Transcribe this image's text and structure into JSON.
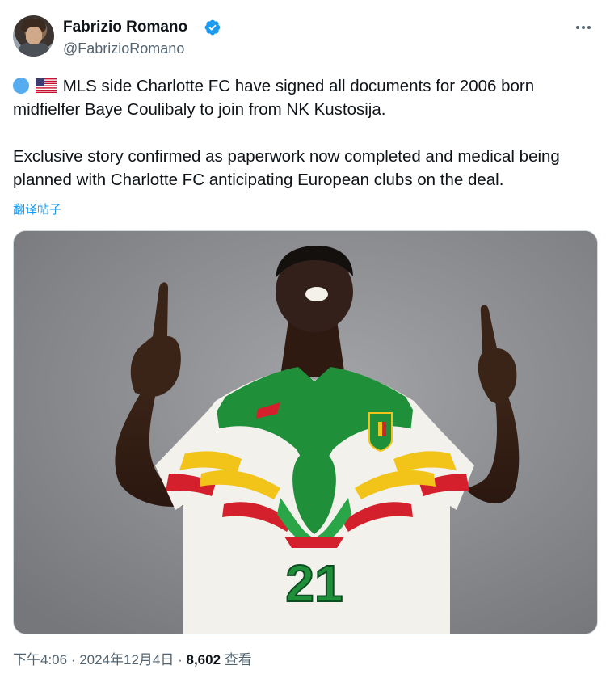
{
  "author": {
    "name": "Fabrizio Romano",
    "handle": "@FabrizioRomano"
  },
  "tweet": {
    "paragraph1": "MLS side Charlotte FC have signed all documents for 2006 born midfielfer Baye Coulibaly to join from NK Kustosija.",
    "paragraph2": "Exclusive story confirmed as paperwork now completed and medical being planned with Charlotte FC anticipating European clubs on the deal.",
    "translate_label": "翻译帖子"
  },
  "media": {
    "jersey_number": "21"
  },
  "meta": {
    "time": "下午4:06",
    "separator1": " · ",
    "date": "2024年12月4日",
    "separator2": " · ",
    "views_count": "8,602",
    "views_label": "查看"
  },
  "colors": {
    "link": "#1d9bf0",
    "secondary_text": "#536471",
    "verified": "#1d9bf0",
    "jersey_green": "#1f8f3a",
    "jersey_yellow": "#f2c318",
    "jersey_red": "#d4202c"
  },
  "icons": [
    "verified-badge-icon",
    "more-options-icon",
    "blue-circle-emoji",
    "us-flag-emoji"
  ]
}
